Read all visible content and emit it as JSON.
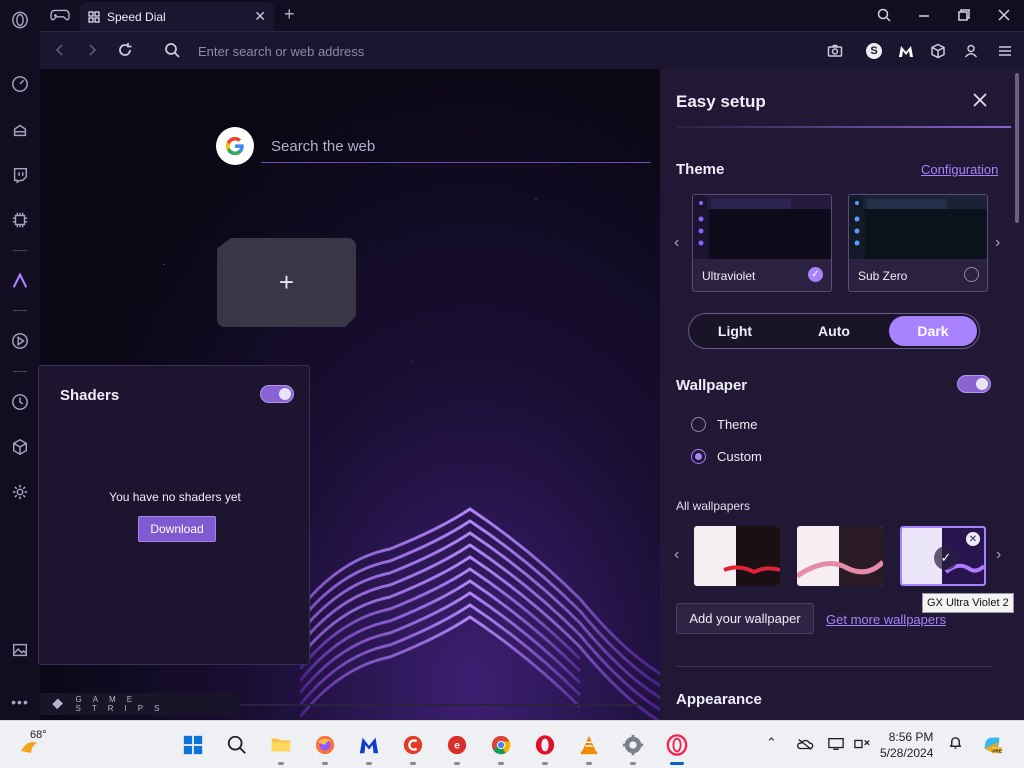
{
  "tab": {
    "title": "Speed Dial"
  },
  "address_bar": {
    "placeholder": "Enter search or web address"
  },
  "speed_dial": {
    "search_placeholder": "Search the web",
    "add_tile_symbol": "+"
  },
  "shaders": {
    "title": "Shaders",
    "enabled": true,
    "empty_message": "You have no shaders yet",
    "download_label": "Download"
  },
  "game_strips": {
    "label": "GAME STRIPS"
  },
  "easy_setup": {
    "title": "Easy setup",
    "theme": {
      "section_title": "Theme",
      "config_link": "Configuration",
      "cards": [
        {
          "name": "Ultraviolet",
          "selected": true
        },
        {
          "name": "Sub Zero",
          "selected": false
        }
      ],
      "modes": [
        "Light",
        "Auto",
        "Dark"
      ],
      "active_mode": "Dark"
    },
    "wallpaper": {
      "section_title": "Wallpaper",
      "enabled": true,
      "options": [
        {
          "label": "Theme",
          "selected": false
        },
        {
          "label": "Custom",
          "selected": true
        }
      ],
      "all_title": "All wallpapers",
      "tooltip": "GX Ultra Violet 2",
      "add_label": "Add your wallpaper",
      "more_link": "Get more wallpapers"
    },
    "appearance": {
      "section_title": "Appearance"
    }
  },
  "taskbar": {
    "weather": "68°",
    "time": "8:56 PM",
    "date": "5/28/2024"
  },
  "colors": {
    "accent": "#a882ff",
    "background": "#0b0816",
    "panel": "#201834"
  }
}
